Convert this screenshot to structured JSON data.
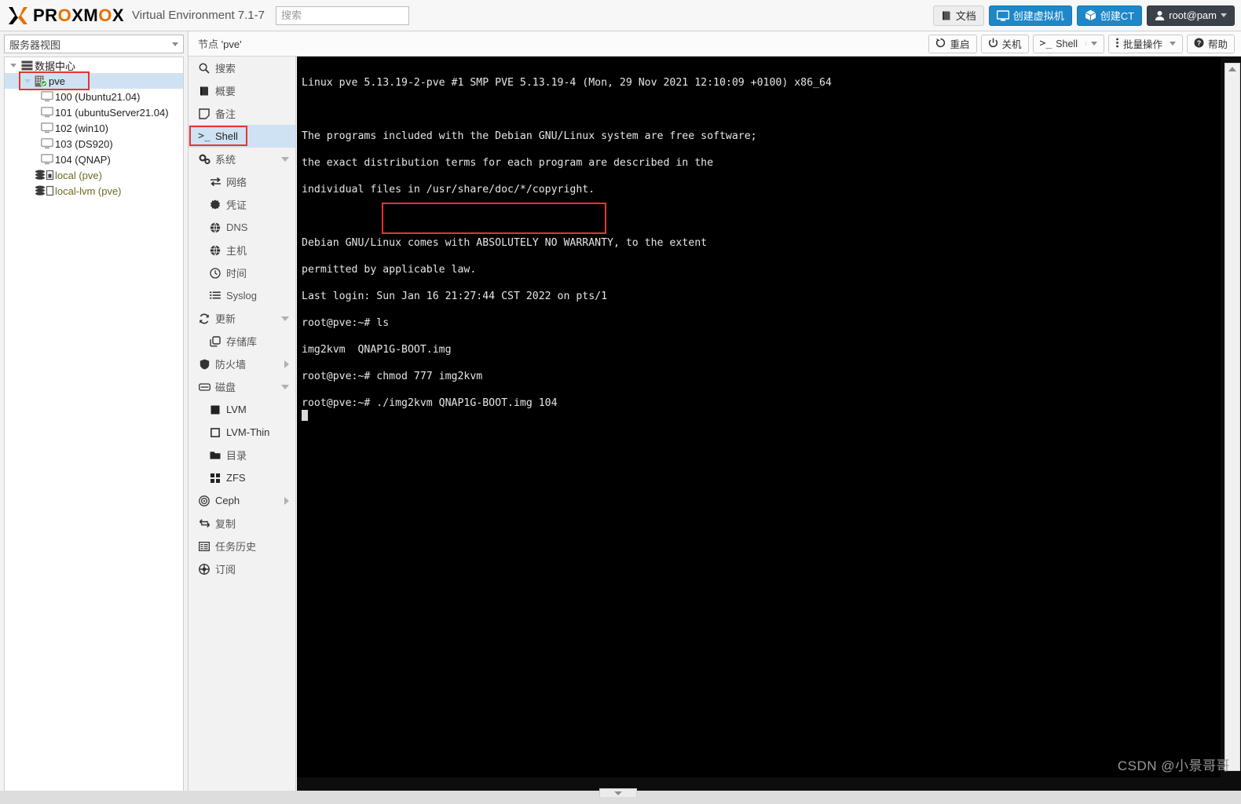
{
  "header": {
    "logo_text_part1": "PR",
    "logo_o": "O",
    "logo_text_part2": "XM",
    "logo_o2": "O",
    "logo_text_part3": "X",
    "product": "Virtual Environment 7.1-7",
    "search_placeholder": "搜索",
    "search_value": "",
    "buttons": [
      {
        "label": "文档",
        "icon": "book-icon",
        "style": "grey"
      },
      {
        "label": "创建虚拟机",
        "icon": "monitor-icon",
        "style": "blue"
      },
      {
        "label": "创建CT",
        "icon": "box-icon",
        "style": "blue"
      },
      {
        "label": "root@pam",
        "icon": "user-icon",
        "style": "dark"
      }
    ]
  },
  "node_toolbar": {
    "title_prefix": "节点 ",
    "title_name": "'pve'",
    "buttons": [
      {
        "label": "重启",
        "icon": "restart-icon"
      },
      {
        "label": "关机",
        "icon": "power-icon"
      },
      {
        "label": "Shell",
        "icon": "shell-prompt-icon",
        "split": true
      },
      {
        "label": "批量操作",
        "icon": "kebab-icon",
        "split": false,
        "caret": true
      },
      {
        "label": "帮助",
        "icon": "help-icon"
      }
    ]
  },
  "sidebar": {
    "view_label": "服务器视图",
    "tree": [
      {
        "label": "数据中心",
        "icon": "datacenter-icon",
        "depth": 0,
        "arrow": true,
        "selected": false,
        "type": "datacenter"
      },
      {
        "label": "pve",
        "icon": "node-online-icon",
        "depth": 1,
        "arrow": true,
        "selected": true,
        "type": "node",
        "highlighted": true
      },
      {
        "label": "100 (Ubuntu21.04)",
        "icon": "vm-icon",
        "depth": 2,
        "arrow": false,
        "selected": false,
        "type": "vm"
      },
      {
        "label": "101 (ubuntuServer21.04)",
        "icon": "vm-icon",
        "depth": 2,
        "arrow": false,
        "selected": false,
        "type": "vm"
      },
      {
        "label": "102 (win10)",
        "icon": "vm-icon",
        "depth": 2,
        "arrow": false,
        "selected": false,
        "type": "vm"
      },
      {
        "label": "103 (DS920)",
        "icon": "vm-icon",
        "depth": 2,
        "arrow": false,
        "selected": false,
        "type": "vm"
      },
      {
        "label": "104 (QNAP)",
        "icon": "vm-icon",
        "depth": 2,
        "arrow": false,
        "selected": false,
        "type": "vm"
      },
      {
        "label": "local (pve)",
        "icon": "storage-icon",
        "depth": 2,
        "arrow": false,
        "selected": false,
        "type": "storage"
      },
      {
        "label": "local-lvm (pve)",
        "icon": "storage-icon",
        "depth": 2,
        "arrow": false,
        "selected": false,
        "type": "storage"
      }
    ]
  },
  "node_menu": [
    {
      "label": "搜索",
      "icon": "search-icon",
      "sub": false,
      "selected": false,
      "expander": ""
    },
    {
      "label": "概要",
      "icon": "book-icon",
      "sub": false,
      "selected": false,
      "expander": ""
    },
    {
      "label": "备注",
      "icon": "note-icon",
      "sub": false,
      "selected": false,
      "expander": ""
    },
    {
      "label": "Shell",
      "icon": "shell-prompt-icon",
      "sub": false,
      "selected": true,
      "expander": "",
      "highlighted": true
    },
    {
      "label": "系统",
      "icon": "gears-icon",
      "sub": false,
      "selected": false,
      "expander": "down"
    },
    {
      "label": "网络",
      "icon": "network-icon",
      "sub": true,
      "selected": false,
      "expander": ""
    },
    {
      "label": "凭证",
      "icon": "certificate-icon",
      "sub": true,
      "selected": false,
      "expander": ""
    },
    {
      "label": "DNS",
      "icon": "globe-icon",
      "sub": true,
      "selected": false,
      "expander": ""
    },
    {
      "label": "主机",
      "icon": "globe-icon",
      "sub": true,
      "selected": false,
      "expander": ""
    },
    {
      "label": "时间",
      "icon": "clock-icon",
      "sub": true,
      "selected": false,
      "expander": ""
    },
    {
      "label": "Syslog",
      "icon": "list-icon",
      "sub": true,
      "selected": false,
      "expander": ""
    },
    {
      "label": "更新",
      "icon": "refresh-icon",
      "sub": false,
      "selected": false,
      "expander": "down"
    },
    {
      "label": "存储库",
      "icon": "repository-icon",
      "sub": true,
      "selected": false,
      "expander": ""
    },
    {
      "label": "防火墙",
      "icon": "shield-icon",
      "sub": false,
      "selected": false,
      "expander": "right"
    },
    {
      "label": "磁盘",
      "icon": "disk-icon",
      "sub": false,
      "selected": false,
      "expander": "down"
    },
    {
      "label": "LVM",
      "icon": "square-filled-icon",
      "sub": true,
      "selected": false,
      "expander": ""
    },
    {
      "label": "LVM-Thin",
      "icon": "square-outline-icon",
      "sub": true,
      "selected": false,
      "expander": ""
    },
    {
      "label": "目录",
      "icon": "folder-icon",
      "sub": true,
      "selected": false,
      "expander": ""
    },
    {
      "label": "ZFS",
      "icon": "grid-icon",
      "sub": true,
      "selected": false,
      "expander": ""
    },
    {
      "label": "Ceph",
      "icon": "ceph-icon",
      "sub": false,
      "selected": false,
      "expander": "right"
    },
    {
      "label": "复制",
      "icon": "replicate-icon",
      "sub": false,
      "selected": false,
      "expander": ""
    },
    {
      "label": "任务历史",
      "icon": "tasks-icon",
      "sub": false,
      "selected": false,
      "expander": ""
    },
    {
      "label": "订阅",
      "icon": "subscription-icon",
      "sub": false,
      "selected": false,
      "expander": ""
    }
  ],
  "terminal": {
    "lines": [
      "Linux pve 5.13.19-2-pve #1 SMP PVE 5.13.19-4 (Mon, 29 Nov 2021 12:10:09 +0100) x86_64",
      "",
      "The programs included with the Debian GNU/Linux system are free software;",
      "the exact distribution terms for each program are described in the",
      "individual files in /usr/share/doc/*/copyright.",
      "",
      "Debian GNU/Linux comes with ABSOLUTELY NO WARRANTY, to the extent",
      "permitted by applicable law.",
      "Last login: Sun Jan 16 21:27:44 CST 2022 on pts/1",
      "root@pve:~# ls",
      "img2kvm  QNAP1G-BOOT.img",
      "root@pve:~# chmod 777 img2kvm",
      "root@pve:~# ./img2kvm QNAP1G-BOOT.img 104 "
    ],
    "prompt": "root@pve:~#",
    "commands_highlighted": [
      "chmod 777 img2kvm",
      "./img2kvm QNAP1G-BOOT.img 104"
    ]
  },
  "watermark": "CSDN @小景哥哥",
  "colors": {
    "brand_orange": "#e87000",
    "accent_blue": "#1e87c8",
    "selection_blue": "#cfe2f3",
    "annotation_red": "#e8352b",
    "terminal_bg": "#000000",
    "terminal_fg": "#e6e6e6"
  }
}
